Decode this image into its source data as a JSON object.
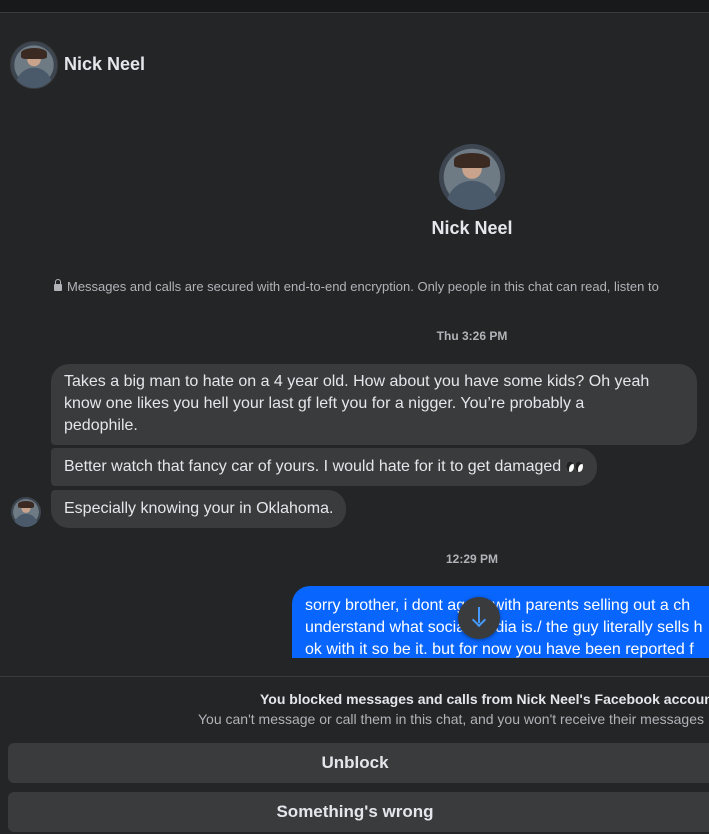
{
  "header": {
    "name": "Nick Neel"
  },
  "profile": {
    "name": "Nick Neel"
  },
  "encryption_notice": "Messages and calls are secured with end-to-end encryption. Only people in this chat can read, listen to",
  "timestamps": [
    "Thu 3:26 PM",
    "12:29 PM"
  ],
  "messages": [
    {
      "sender": "Nick Neel",
      "lines": [
        "Takes a big man to hate on a 4 year old. How about you have some kids? Oh yeah",
        "know one likes you hell your last gf left you for a nigger. You’re probably a",
        "pedophile."
      ]
    },
    {
      "sender": "Nick Neel",
      "text": "Better watch that fancy car of yours. I would hate for it to get damaged"
    },
    {
      "sender": "Nick Neel",
      "text": "Especially knowing your in Oklahoma."
    },
    {
      "sender": "me",
      "lines": [
        "sorry brother, i dont agree with parents selling out a ch",
        "understand what social media is./ the guy literally sells h",
        "ok with it so be it. but for now you have been reported f"
      ]
    }
  ],
  "footer": {
    "blocked_title": "You blocked messages and calls from Nick Neel's Facebook account",
    "blocked_subtitle": "You can't message or call them in this chat, and you won't receive their messages",
    "unblock_label": "Unblock",
    "wrong_label": "Something's wrong"
  },
  "icons": {
    "lock": "lock-icon",
    "scroll": "arrow-down-icon",
    "emoji": "eyes-icon"
  },
  "colors": {
    "background": "#242526",
    "bubble_in": "#3a3b3c",
    "bubble_out": "#0866ff",
    "accent": "#4599ff"
  }
}
